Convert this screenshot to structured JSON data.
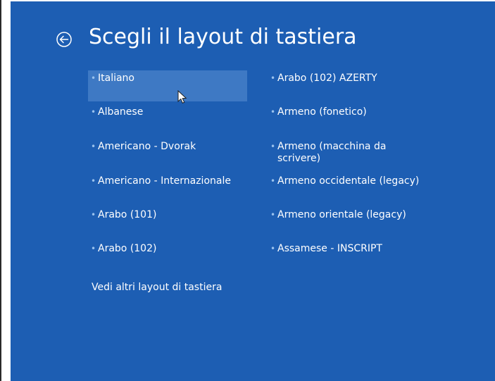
{
  "screen": {
    "title": "Scegli il layout di tastiera",
    "back_icon": "back-arrow-circle-icon",
    "more_link": "Vedi altri layout di tastiera"
  },
  "layouts": {
    "left": [
      {
        "label": "Italiano",
        "selected": true
      },
      {
        "label": "Albanese"
      },
      {
        "label": "Americano - Dvorak"
      },
      {
        "label": "Americano - Internazionale"
      },
      {
        "label": "Arabo (101)"
      },
      {
        "label": "Arabo (102)"
      }
    ],
    "right": [
      {
        "label": "Arabo (102) AZERTY"
      },
      {
        "label": "Armeno (fonetico)"
      },
      {
        "label": "Armeno (macchina da scrivere)"
      },
      {
        "label": "Armeno occidentale (legacy)"
      },
      {
        "label": "Armeno orientale (legacy)"
      },
      {
        "label": "Assamese - INSCRIPT"
      }
    ]
  },
  "colors": {
    "background": "#1d5eb3",
    "selected": "#3e79c4",
    "text": "#ffffff"
  }
}
